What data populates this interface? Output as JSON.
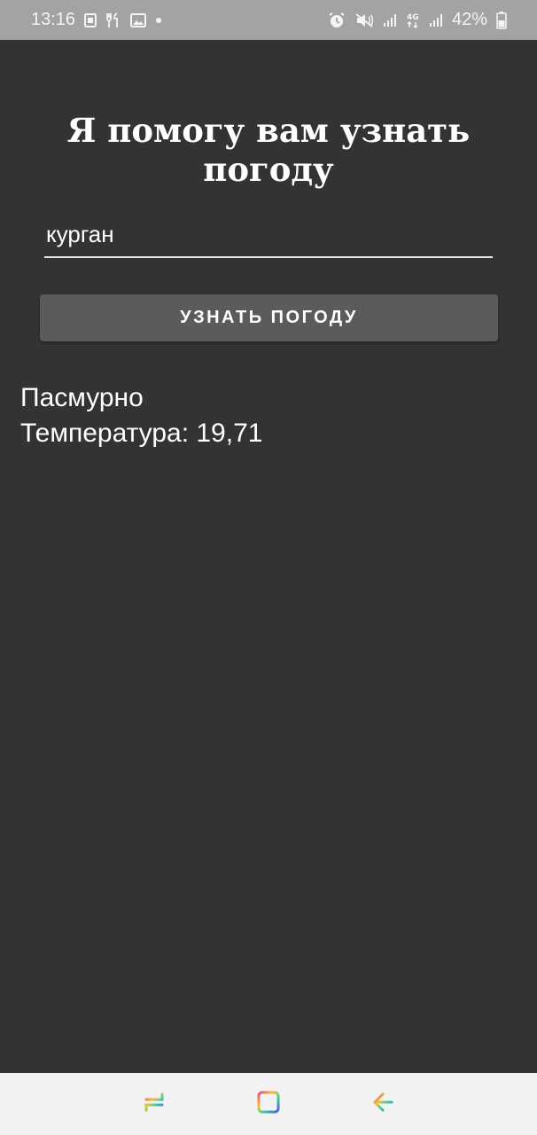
{
  "status_bar": {
    "time": "13:16",
    "battery": "42%",
    "left_icons": [
      "sim-card-icon",
      "restaurant-icon",
      "image-icon",
      "dot-icon"
    ],
    "right_icons": [
      "alarm-icon",
      "mute-vibrate-icon",
      "signal-icon",
      "4g-data-icon",
      "signal-icon",
      "battery-icon"
    ]
  },
  "app": {
    "title": "Я помогу вам узнать погоду",
    "input": {
      "value": "курган",
      "placeholder": ""
    },
    "button_label": "УЗНАТЬ ПОГОДУ",
    "result": {
      "condition": "Пасмурно",
      "temperature": "Температура: 19,71"
    }
  },
  "nav_bar": {
    "recents": "recents-icon",
    "home": "home-icon",
    "back": "back-icon"
  },
  "colors": {
    "background": "#333333",
    "status_bar": "#a3a3a3",
    "button": "#5b5b5b",
    "nav_bar": "#f2f2f2"
  }
}
